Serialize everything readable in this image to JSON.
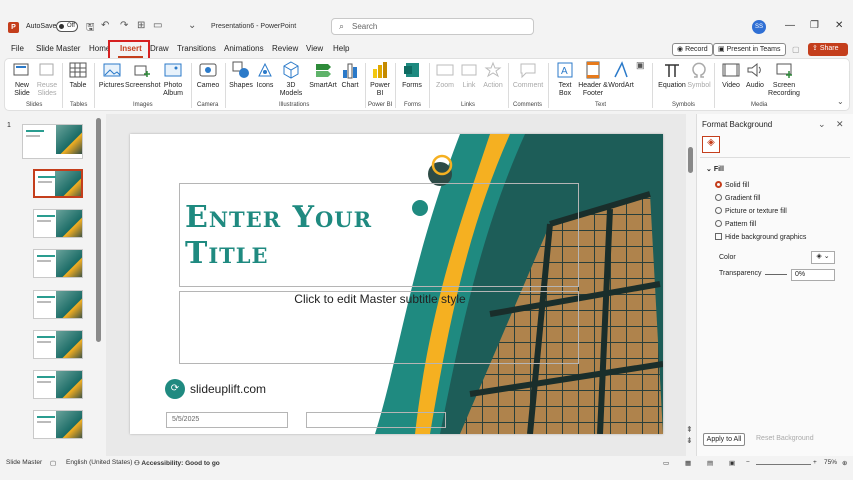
{
  "titlebar": {
    "autosave_label": "AutoSave",
    "autosave_state": "Off",
    "doc_title": "Presentation6 - PowerPoint",
    "search_placeholder": "Search",
    "avatar_initials": "SS"
  },
  "menu": {
    "tabs": [
      "File",
      "Slide Master",
      "Home",
      "Insert",
      "Draw",
      "Transitions",
      "Animations",
      "Review",
      "View",
      "Help"
    ],
    "active": "Insert",
    "record": "Record",
    "present_teams": "Present in Teams",
    "share": "Share"
  },
  "ribbon": {
    "new_slide": "New Slide",
    "reuse_slides": "Reuse Slides",
    "table": "Table",
    "pictures": "Pictures",
    "screenshot": "Screenshot",
    "photo_album": "Photo Album",
    "cameo": "Cameo",
    "shapes": "Shapes",
    "icons": "Icons",
    "models_3d": "3D Models",
    "smartart": "SmartArt",
    "chart": "Chart",
    "power_bi": "Power BI",
    "forms": "Forms",
    "zoom": "Zoom",
    "link": "Link",
    "action": "Action",
    "comment": "Comment",
    "text_box": "Text Box",
    "header_footer": "Header & Footer",
    "wordart": "WordArt",
    "equation": "Equation",
    "symbol": "Symbol",
    "video": "Video",
    "audio": "Audio",
    "screen_recording": "Screen Recording",
    "groups": [
      "Slides",
      "Tables",
      "Images",
      "Camera",
      "Illustrations",
      "Power BI",
      "Forms",
      "Links",
      "Comments",
      "Text",
      "Symbols",
      "Media"
    ]
  },
  "thumbs": {
    "number": "1"
  },
  "slide": {
    "title_line1": "Enter Your",
    "title_line2": "Title",
    "subtitle": "Click to edit Master subtitle style",
    "logo_text": "slideuplift.com",
    "date": "5/5/2025"
  },
  "format_panel": {
    "title": "Format Background",
    "fill_header": "Fill",
    "options": [
      "Solid fill",
      "Gradient fill",
      "Picture or texture fill",
      "Pattern fill"
    ],
    "hide_bg": "Hide background graphics",
    "color_label": "Color",
    "transparency_label": "Transparency",
    "transparency_value": "0%",
    "transparency_fraction": 0,
    "apply_all": "Apply to All",
    "reset": "Reset Background"
  },
  "status": {
    "view": "Slide Master",
    "language": "English (United States)",
    "accessibility": "Accessibility: Good to go",
    "zoom": "75%"
  },
  "colors": {
    "accent": "#c43e1c",
    "teal": "#1f8a80",
    "gold": "#f5b021"
  }
}
